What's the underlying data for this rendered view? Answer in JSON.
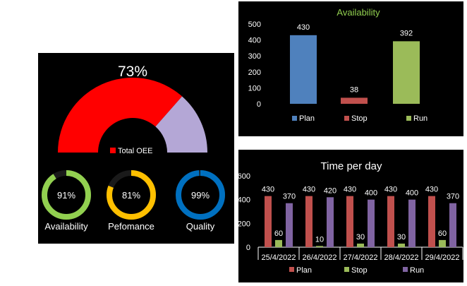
{
  "colors": {
    "plan_avail": "#4f81bd",
    "plan": "#c0504d",
    "stop": "#9bbb59",
    "run": "#8064a2",
    "gauge_fill": "#ff0000",
    "gauge_rest": "#b4a7d6",
    "ring_availability": "#92d050",
    "ring_performance": "#ffc000",
    "ring_quality": "#0070c0",
    "axis_text": "#ffffff",
    "title_green": "#92d050"
  },
  "chart_data": [
    {
      "type": "gauge",
      "value": 0.73,
      "value_label": "73%",
      "legend": [
        "Total OEE"
      ]
    },
    {
      "type": "donut",
      "items": [
        {
          "name": "Availability",
          "value": 0.91,
          "value_label": "91%"
        },
        {
          "name": "Pefomance",
          "value": 0.81,
          "value_label": "81%"
        },
        {
          "name": "Quality",
          "value": 0.99,
          "value_label": "99%"
        }
      ]
    },
    {
      "type": "bar",
      "title": "Availability",
      "categories": [
        "Plan",
        "Stop",
        "Run"
      ],
      "values": [
        430,
        38,
        392
      ],
      "ylim": [
        0,
        500
      ],
      "yticks": [
        0,
        100,
        200,
        300,
        400,
        500
      ],
      "grid": false,
      "legend_position": "bottom"
    },
    {
      "type": "bar",
      "title": "Time per day",
      "categories": [
        "25/4/2022",
        "26/4/2022",
        "27/4/2022",
        "28/4/2022",
        "29/4/2022"
      ],
      "series": [
        {
          "name": "Plan",
          "values": [
            430,
            430,
            430,
            430,
            430
          ]
        },
        {
          "name": "Stop",
          "values": [
            60,
            10,
            30,
            30,
            60
          ]
        },
        {
          "name": "Run",
          "values": [
            370,
            420,
            400,
            400,
            370
          ]
        }
      ],
      "ylim": [
        0,
        600
      ],
      "yticks": [
        0,
        200,
        400,
        600
      ],
      "grid": false,
      "legend_position": "bottom"
    }
  ]
}
